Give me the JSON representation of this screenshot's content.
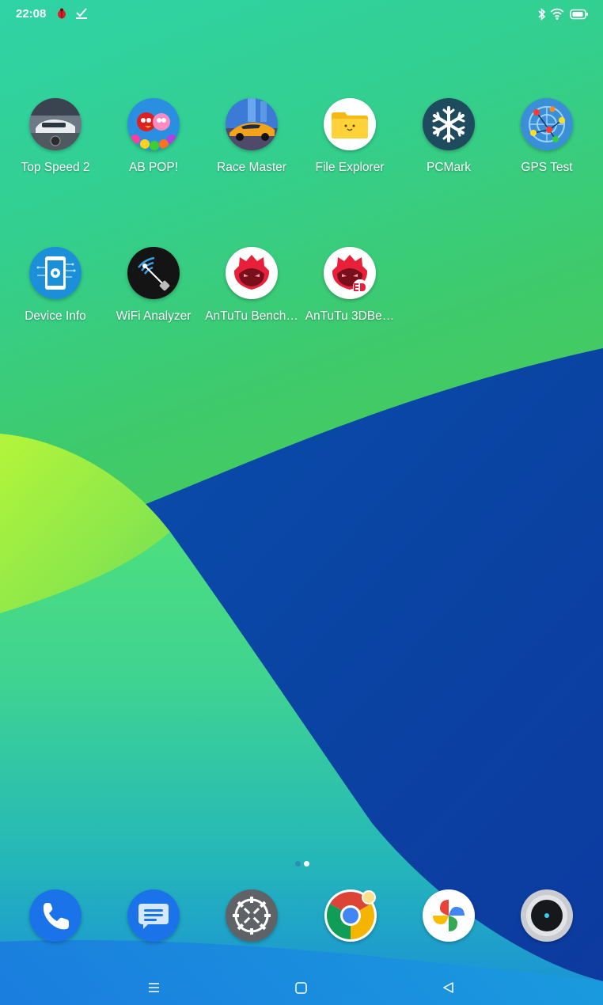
{
  "status_bar": {
    "time": "22:08",
    "notifications": [
      "bug-icon",
      "task-check-icon"
    ],
    "indicators": [
      "bluetooth-icon",
      "wifi-icon",
      "battery-icon"
    ]
  },
  "home": {
    "rows": [
      [
        {
          "label": "Top Speed 2",
          "icon": "car-game-icon"
        },
        {
          "label": "AB POP!",
          "icon": "angry-birds-icon"
        },
        {
          "label": "Race Master",
          "icon": "race-car-icon"
        },
        {
          "label": "File Explorer",
          "icon": "folder-icon"
        },
        {
          "label": "PCMark",
          "icon": "snowflake-icon"
        },
        {
          "label": "GPS Test",
          "icon": "gps-network-icon"
        }
      ],
      [
        {
          "label": "Device Info",
          "icon": "phone-gear-icon"
        },
        {
          "label": "WiFi Analyzer",
          "icon": "wifi-radar-icon"
        },
        {
          "label": "AnTuTu Bench…",
          "icon": "antutu-icon"
        },
        {
          "label": "AnTuTu 3DBe…",
          "icon": "antutu-3d-icon"
        }
      ]
    ],
    "page_indicator": {
      "pages": 2,
      "current": 2
    }
  },
  "dock": [
    {
      "name": "Phone",
      "icon": "phone-icon"
    },
    {
      "name": "Messages",
      "icon": "messages-icon"
    },
    {
      "name": "Settings",
      "icon": "settings-icon"
    },
    {
      "name": "Chrome",
      "icon": "chrome-icon"
    },
    {
      "name": "Photos",
      "icon": "photos-icon"
    },
    {
      "name": "Camera",
      "icon": "camera-icon"
    }
  ],
  "nav_bar": [
    "menu-icon",
    "home-icon",
    "back-icon"
  ],
  "colors": {
    "wallpaper_green": "#3fca6a",
    "wallpaper_blue": "#0d3fa0",
    "wallpaper_lime": "#a6f03a",
    "label_text": "#ffffff",
    "dot_active": "#ffffff",
    "dot_inactive": "#2a8fb0"
  }
}
